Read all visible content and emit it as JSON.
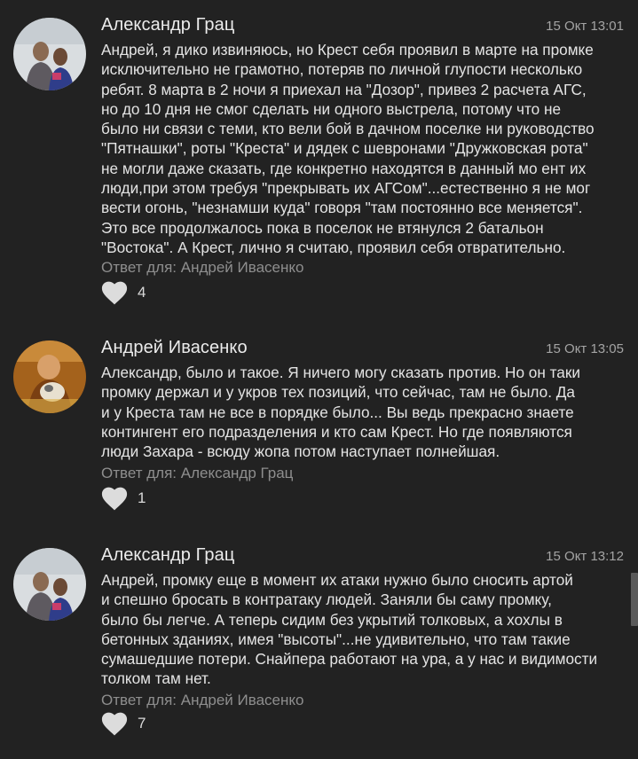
{
  "comments": [
    {
      "author": "Александр Грац",
      "time": "15 Окт 13:01",
      "avatar_icon": "user-photo-avatar",
      "lines": [
        "Андрей, я дико извиняюсь, но Крест себя проявил в марте на промке",
        "исключительно не грамотно, потеряв по личной глупости несколько",
        "ребят. 8 марта в 2 ночи я приехал на \"Дозор\", привез 2 расчета АГС,",
        "но до 10 дня не смог сделать ни одного выстрела, потому что не",
        "было ни связи с теми, кто вели бой в дачном поселке ни руководство",
        "\"Пятнашки\", роты \"Креста\" и дядек с шевронами \"Дружковская рота\"",
        "не могли даже сказать, где конкретно находятся в данный мо ент их",
        "люди,при этом требуя \"прекрывать их АГСом\"...естественно я не мог",
        "вести огонь, \"незнамши куда\"  говоря \"там постоянно все меняется\".",
        "Это все продолжалось пока в поселок не втянулся 2 батальон",
        "\"Востока\". А Крест, лично я считаю, проявил себя отвратительно."
      ],
      "reply_to": "Ответ для: Андрей Ивасенко",
      "likes": "4"
    },
    {
      "author": "Андрей Ивасенко",
      "time": "15 Окт 13:05",
      "avatar_icon": "user-photo-avatar",
      "lines": [
        "Александр, было и такое. Я ничего могу сказать против. Но он таки",
        "промку держал и у укров тех позиций, что сейчас, там не было. Да",
        "и у Креста там не все в порядке было... Вы ведь прекрасно знаете",
        "контингент его подразделения и кто сам Крест. Но где появляются",
        "люди Захара - всюду жопа потом наступает полнейшая."
      ],
      "reply_to": "Ответ для: Александр Грац",
      "likes": "1"
    },
    {
      "author": "Александр Грац",
      "time": "15 Окт 13:12",
      "avatar_icon": "user-photo-avatar",
      "lines": [
        "Андрей, промку еще в момент их атаки нужно было сносить артой",
        "и спешно бросать в контратаку людей. Заняли бы саму промку,",
        "было бы легче. А теперь сидим без укрытий толковых, а хохлы в",
        "бетонных зданиях, имея \"высоты\"...не удивительно, что там такие",
        "сумашедшие потери. Снайпера работают на ура, а у нас и видимости",
        "толком там нет."
      ],
      "reply_to": "Ответ для: Андрей Ивасенко",
      "likes": "7"
    }
  ],
  "colors": {
    "background": "#222222",
    "author": "#ececec",
    "text": "#e4e4e4",
    "meta": "#8e8e8e",
    "heart": "#dcdcdc"
  }
}
